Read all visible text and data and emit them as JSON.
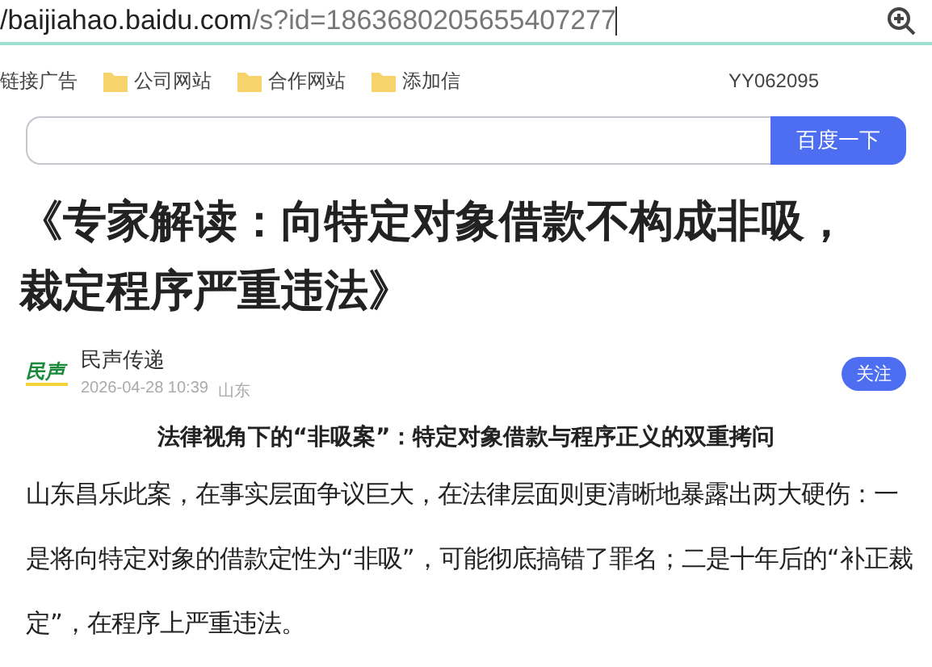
{
  "address_bar": {
    "url_host": "/baijiahao.baidu.com",
    "url_path": "/s?id=1863680205655407277"
  },
  "bookmarks": {
    "items": [
      "链接广告",
      "公司网站",
      "合作网站",
      "添加信"
    ],
    "watermark_code": "YY062095"
  },
  "search": {
    "button": "百度一下"
  },
  "article": {
    "title_lines": [
      "《专家解读：向特定对象借款不构成非吸，",
      "裁定程序严重违法》"
    ],
    "author": {
      "logo": "民声",
      "name": "民声传递",
      "time": "2026-04-28 10:39",
      "location": "山东",
      "follow": "关注"
    },
    "subheading": "法律视角下的“非吸案”：特定对象借款与程序正义的双重拷问",
    "paragraph": "山东昌乐此案，在事实层面争议巨大，在法律层面则更清晰地暴露出两大硬伤：一是将向特定对象的借款定性为“非吸”，可能彻底搞错了罪名；二是十年后的“补正裁定”，在程序上严重违法。"
  }
}
